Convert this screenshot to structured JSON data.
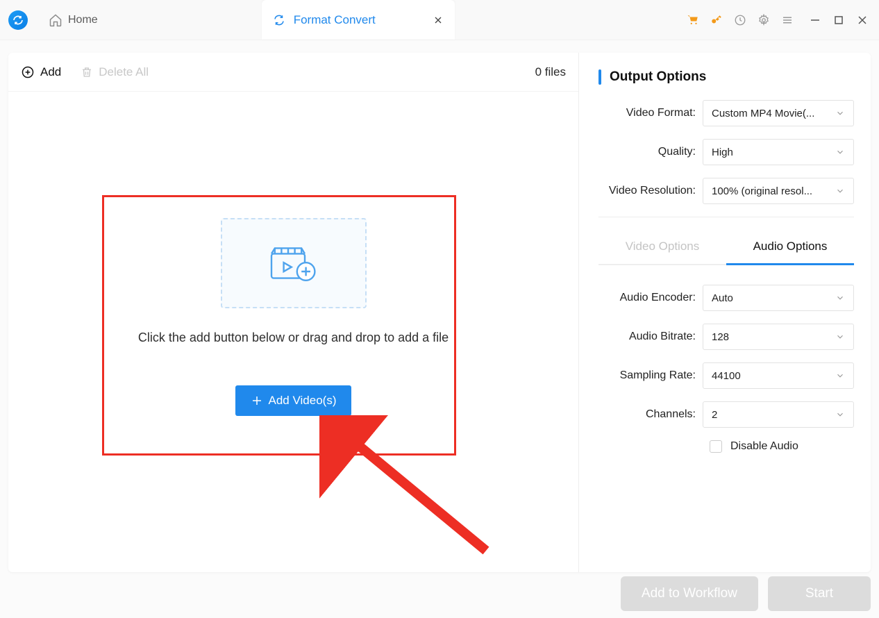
{
  "titlebar": {
    "home_label": "Home",
    "active_tab_label": "Format Convert"
  },
  "toolbar": {
    "add_label": "Add",
    "delete_all_label": "Delete All",
    "file_count": "0 files"
  },
  "dropzone": {
    "instruction": "Click the add button below or drag and drop to add a file",
    "add_video_label": "Add Video(s)"
  },
  "output": {
    "section_title": "Output Options",
    "video_format_label": "Video Format:",
    "video_format_value": "Custom MP4 Movie(...",
    "quality_label": "Quality:",
    "quality_value": "High",
    "resolution_label": "Video Resolution:",
    "resolution_value": "100% (original resol..."
  },
  "tabs": {
    "video_options": "Video Options",
    "audio_options": "Audio Options"
  },
  "audio": {
    "encoder_label": "Audio Encoder:",
    "encoder_value": "Auto",
    "bitrate_label": "Audio Bitrate:",
    "bitrate_value": "128",
    "sampling_label": "Sampling Rate:",
    "sampling_value": "44100",
    "channels_label": "Channels:",
    "channels_value": "2",
    "disable_label": "Disable Audio"
  },
  "footer": {
    "workflow_label": "Add to Workflow",
    "start_label": "Start"
  }
}
